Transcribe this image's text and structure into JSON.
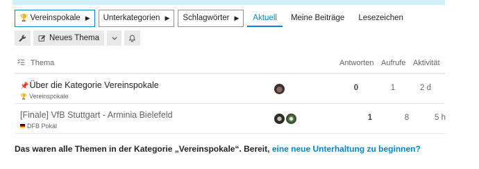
{
  "nav": {
    "category_dropdown": "Vereinspokale",
    "subcategory_dropdown": "Unterkategorien",
    "tags_dropdown": "Schlagwörter",
    "tabs": [
      {
        "label": "Aktuell",
        "active": true
      },
      {
        "label": "Meine Beiträge",
        "active": false
      },
      {
        "label": "Lesezeichen",
        "active": false
      }
    ]
  },
  "actions": {
    "new_topic_label": "Neues Thema"
  },
  "table": {
    "columns": {
      "topic": "Thema",
      "replies": "Antworten",
      "views": "Aufrufe",
      "activity": "Aktivität"
    },
    "rows": [
      {
        "title": "Über die Kategorie Vereinspokale",
        "category": "Vereinspokale",
        "replies": "0",
        "views": "1",
        "activity": "2 d",
        "pinned": true
      },
      {
        "title": "[Finale] VfB Stuttgart - Arminia Bielefeld",
        "category": "DFB Pokal",
        "replies": "1",
        "views": "8",
        "activity": "5 h",
        "pinned": false
      }
    ]
  },
  "footer": {
    "text": "Das waren alle Themen in der Kategorie „Vereinspokale“. Bereit, ",
    "link": "eine neue Unterhaltung zu beginnen?"
  },
  "colors": {
    "accent": "#0088cc",
    "banner": "#d1f0ff",
    "category_trophy": "#e2a83b"
  },
  "icons": [
    "trophy-icon",
    "caret-right-icon",
    "wrench-icon",
    "edit-icon",
    "chevron-down-icon",
    "bell-icon",
    "list-icon",
    "pin-icon",
    "flag-icon"
  ]
}
